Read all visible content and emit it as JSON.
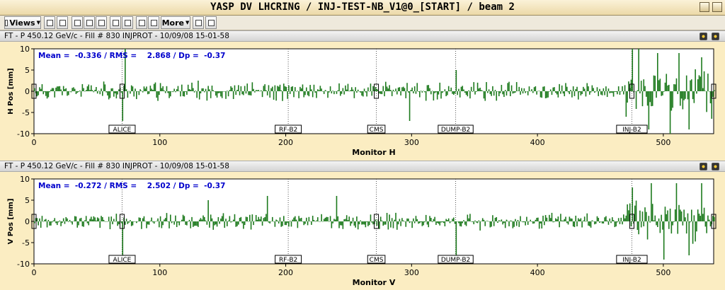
{
  "window": {
    "title": "YASP DV LHCRING / INJ-TEST-NB_V1@0_[START] / beam 2"
  },
  "toolbar": {
    "views_label": "Views",
    "more_label": "More"
  },
  "stats_colors": {
    "text": "#0000cc",
    "bars": "#1d7a1d",
    "plot_bg": "#fbedc2"
  },
  "panels": [
    {
      "header": "FT - P 450.12 GeV/c - Fill # 830 INJPROT - 10/09/08 15-01-58",
      "stats": "Mean =  -0.336 / RMS =    2.868 / Dp =  -0.37",
      "ylabel": "H Pos [mm]",
      "xlabel": "Monitor H",
      "chart_data": {
        "type": "bar",
        "ylim": [
          -10,
          10
        ],
        "xlim": [
          0,
          540
        ],
        "yticks": [
          "10",
          "5",
          "0",
          "-5",
          "-10"
        ],
        "xticks": [
          "0",
          "100",
          "200",
          "300",
          "400",
          "500"
        ],
        "markers": [
          {
            "label": "ALICE",
            "x": 70
          },
          {
            "label": "RF-B2",
            "x": 202
          },
          {
            "label": "CMS",
            "x": 272
          },
          {
            "label": "DUMP-B2",
            "x": 335
          },
          {
            "label": "INJ-B2",
            "x": 475
          }
        ],
        "peaks": [
          {
            "x": 72,
            "y": 10
          },
          {
            "x": 70,
            "y": -7
          },
          {
            "x": 475,
            "y": 10
          },
          {
            "x": 480,
            "y": 10
          },
          {
            "x": 488,
            "y": -9
          },
          {
            "x": 495,
            "y": 9
          },
          {
            "x": 505,
            "y": -10
          },
          {
            "x": 512,
            "y": 9
          },
          {
            "x": 520,
            "y": -9
          },
          {
            "x": 530,
            "y": 8
          },
          {
            "x": 335,
            "y": 5
          },
          {
            "x": 298,
            "y": -7
          }
        ],
        "amplitude": 2.87,
        "tail_start": 470,
        "tail_amplitude": 7
      }
    },
    {
      "header": "FT - P 450.12 GeV/c - Fill # 830 INJPROT - 10/09/08 15-01-58",
      "stats": "Mean =  -0.272 / RMS =    2.502 / Dp =  -0.37",
      "ylabel": "V Pos [mm]",
      "xlabel": "Monitor V",
      "chart_data": {
        "type": "bar",
        "ylim": [
          -10,
          10
        ],
        "xlim": [
          0,
          540
        ],
        "yticks": [
          "10",
          "5",
          "0",
          "-5",
          "-10"
        ],
        "xticks": [
          "0",
          "100",
          "200",
          "300",
          "400",
          "500"
        ],
        "markers": [
          {
            "label": "ALICE",
            "x": 70
          },
          {
            "label": "RF-B2",
            "x": 202
          },
          {
            "label": "CMS",
            "x": 272
          },
          {
            "label": "DUMP-B2",
            "x": 335
          },
          {
            "label": "INJ-B2",
            "x": 475
          }
        ],
        "peaks": [
          {
            "x": 70,
            "y": -8
          },
          {
            "x": 335,
            "y": -8
          },
          {
            "x": 185,
            "y": 6
          },
          {
            "x": 240,
            "y": 6
          },
          {
            "x": 475,
            "y": 8
          },
          {
            "x": 490,
            "y": 9
          },
          {
            "x": 500,
            "y": -9
          },
          {
            "x": 510,
            "y": 9
          },
          {
            "x": 520,
            "y": -8
          },
          {
            "x": 530,
            "y": 9
          },
          {
            "x": 138,
            "y": 5
          }
        ],
        "amplitude": 2.5,
        "tail_start": 470,
        "tail_amplitude": 6
      }
    }
  ]
}
